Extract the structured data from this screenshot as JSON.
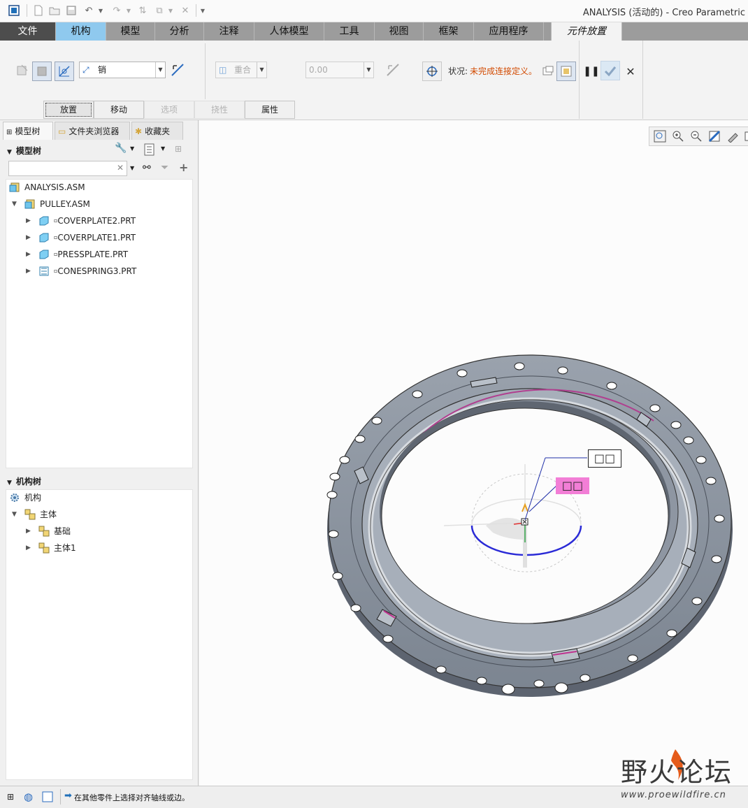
{
  "window": {
    "title": "ANALYSIS (活动的) - Creo Parametric"
  },
  "ribbon_tabs": [
    "文件",
    "机构",
    "模型",
    "分析",
    "注释",
    "人体模型",
    "工具",
    "视图",
    "框架",
    "应用程序",
    "元件放置"
  ],
  "ribbon": {
    "constraint_type": "销",
    "constraint_option": "重合",
    "offset_value": "0.00",
    "status_label": "状况:",
    "status_value": "未完成连接定义。",
    "subtabs": [
      "放置",
      "移动",
      "选项",
      "挠性",
      "属性"
    ]
  },
  "panel_tabs": [
    "模型树",
    "文件夹浏览器",
    "收藏夹"
  ],
  "model_tree": {
    "header": "模型树",
    "search_value": "",
    "items": [
      {
        "label": "ANALYSIS.ASM"
      },
      {
        "label": "PULLEY.ASM"
      },
      {
        "label": "COVERPLATE2.PRT"
      },
      {
        "label": "COVERPLATE1.PRT"
      },
      {
        "label": "PRESSPLATE.PRT"
      },
      {
        "label": "CONESPRING3.PRT"
      }
    ]
  },
  "mech_tree": {
    "header": "机构树",
    "items": [
      {
        "label": "机构"
      },
      {
        "label": "主体"
      },
      {
        "label": "基础"
      },
      {
        "label": "主体1"
      }
    ]
  },
  "viewport": {
    "label_boxes": [
      "□□",
      "□□"
    ]
  },
  "statusbar": {
    "message": "在其他零件上选择对齐轴线或边。"
  },
  "watermark": {
    "title": "野火论坛",
    "url": "www.proewildfire.cn"
  },
  "colors": {
    "file_tab": "#4d4d4d",
    "mech_tab": "#8fc9ee",
    "status_warning": "#d24a00",
    "part_gray": "#8e96a2",
    "highlight_pink": "#f27ed6"
  }
}
